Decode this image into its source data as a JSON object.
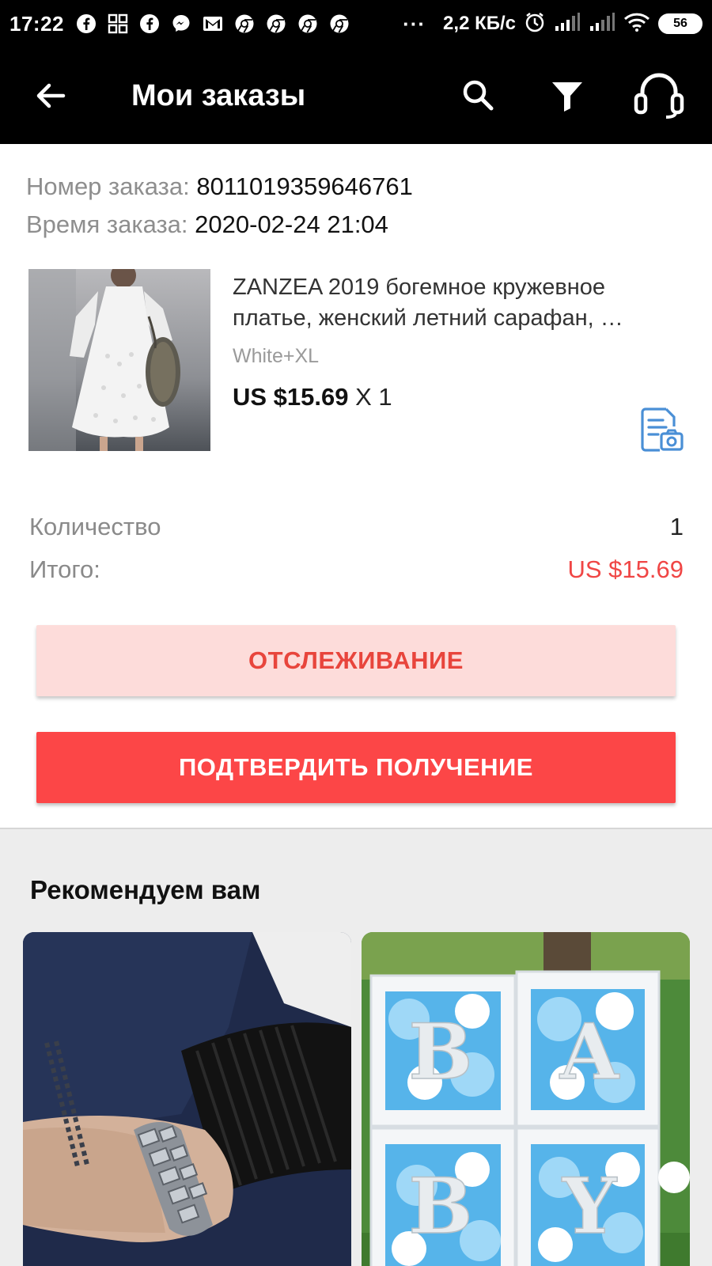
{
  "status_bar": {
    "time": "17:22",
    "dots": "···",
    "network_speed": "2,2 КБ/с",
    "battery": "56"
  },
  "app_bar": {
    "title": "Мои заказы"
  },
  "order": {
    "number_label": "Номер заказа:",
    "number_value": "8011019359646761",
    "time_label": "Время заказа:",
    "time_value": "2020-02-24 21:04"
  },
  "product": {
    "title": "ZANZEA 2019 богемное кружевное платье, женский летний сарафан, …",
    "variant": "White+XL",
    "price": "US $15.69",
    "quantity": "X 1"
  },
  "summary": {
    "quantity_label": "Количество",
    "quantity_value": "1",
    "total_label": "Итого:",
    "total_value": "US $15.69"
  },
  "buttons": {
    "track": "ОТСЛЕЖИВАНИЕ",
    "confirm": "ПОДТВЕРДИТЬ ПОЛУЧЕНИЕ"
  },
  "recommendations": {
    "title": "Рекомендуем вам",
    "box_letters": [
      "B",
      "A",
      "B",
      "Y"
    ]
  },
  "colors": {
    "accent_red": "#fc4647",
    "track_bg": "#fddcda",
    "total_red": "#f04645",
    "icon_blue": "#4a8fd6"
  }
}
